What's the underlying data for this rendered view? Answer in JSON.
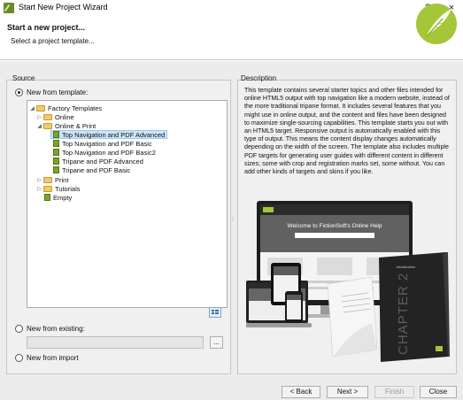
{
  "window": {
    "title": "Start New Project Wizard",
    "help_label": "?",
    "close_label": "×"
  },
  "header": {
    "title": "Start a new project...",
    "subtitle": "Select a project template..."
  },
  "source": {
    "legend": "Source",
    "new_from_template": "New from template:",
    "new_from_existing": "New from existing:",
    "new_from_import": "New from import",
    "browse_label": "...",
    "tree": {
      "root": "Factory Templates",
      "online": "Online",
      "online_print": "Online & Print",
      "templates": [
        "Top Navigation and PDF Advanced",
        "Top Navigation and PDF Basic",
        "Top Navigation and PDF Basic2",
        "Tripane and PDF Advanced",
        "Tripane and PDF Basic"
      ],
      "print": "Print",
      "tutorials": "Tutorials",
      "empty": "Empty"
    }
  },
  "description": {
    "legend": "Description",
    "text": "This template contains several starter topics and other files intended for online HTML5 output with top navigation like a modern website, instead of the more traditional tripane format. It includes several features that you might use in online output, and the content and files have been designed to maximize single-sourcing capabilities. This template starts you out with an HTML5 target. Responsive output is automatically enabled with this type of output. This means the content display changes automatically depending on the width of the screen. The template also includes multiple PDF targets for generating user guides with different content in different sizes; some with crop and registration marks set, some without. You can add other kinds of targets and skins if you like.",
    "preview": {
      "banner": "Welcome to FictionSoft's Online Help",
      "cover_title": "CHAPTER 2",
      "cover_heading": "Introduction"
    }
  },
  "footer": {
    "back": "< Back",
    "next": "Next >",
    "finish": "Finish",
    "close": "Close"
  },
  "colors": {
    "logo": "#a4c639",
    "selection": "#cce4f7",
    "template_icon": "#7aa52a",
    "folder_icon": "#f2c86a"
  }
}
